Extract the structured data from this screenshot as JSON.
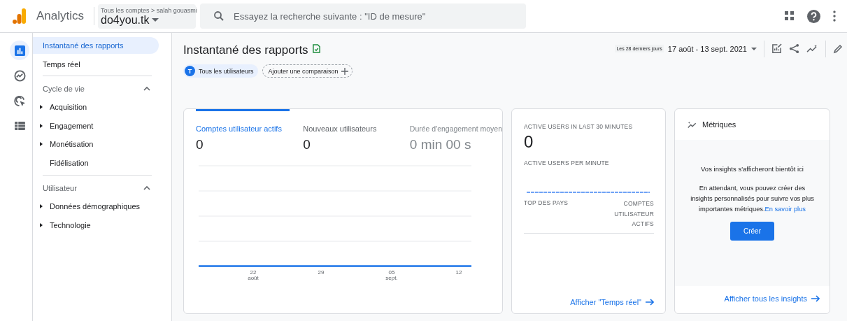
{
  "header": {
    "product": "Analytics",
    "breadcrumb": "Tous les comptes > salah gouasmi",
    "property": "do4you.tk",
    "search": {
      "placeholder": "Essayez la recherche suivante : \"ID de mesure\""
    }
  },
  "rail": [
    {
      "selected": true
    },
    {
      "selected": false
    },
    {
      "selected": false
    },
    {
      "selected": false
    }
  ],
  "sidebar": {
    "items": [
      {
        "label": "Instantané des rapports",
        "selected": true
      },
      {
        "label": "Temps réel",
        "selected": false
      }
    ],
    "sections": [
      {
        "title": "Cycle de vie",
        "expanded": true,
        "items": [
          {
            "label": "Acquisition",
            "kind": "group"
          },
          {
            "label": "Engagement",
            "kind": "group"
          },
          {
            "label": "Monétisation",
            "kind": "group"
          },
          {
            "label": "Fidélisation",
            "kind": "link"
          }
        ]
      },
      {
        "title": "Utilisateur",
        "expanded": true,
        "items": [
          {
            "label": "Données démographiques",
            "kind": "group"
          },
          {
            "label": "Technologie",
            "kind": "group"
          }
        ]
      }
    ]
  },
  "page": {
    "title": "Instantané des rapports",
    "segment": {
      "initial": "T",
      "label": "Tous les utilisateurs"
    },
    "add_comparison": "Ajouter une comparaison",
    "range_label": "Les 28 derniers jours",
    "date_range": "17 août - 13 sept. 2021"
  },
  "overview": {
    "metrics": [
      {
        "label": "Comptes utilisateur actifs",
        "value": "0",
        "selected": true
      },
      {
        "label": "Nouveaux utilisateurs",
        "value": "0",
        "selected": false
      },
      {
        "label": "Durée d'engagement moyen",
        "value": "0 min 00 s",
        "selected": false
      }
    ],
    "x_labels": [
      {
        "day": "22",
        "month": "août"
      },
      {
        "day": "29"
      },
      {
        "day": "05",
        "month": "sept."
      },
      {
        "day": "12"
      }
    ]
  },
  "realtime": {
    "title": "ACTIVE USERS IN LAST 30 MINUTES",
    "value": "0",
    "per_minute": "ACTIVE USERS PER MINUTE",
    "col_country": "TOP DES PAYS",
    "col_users": "COMPTES UTILISATEUR ACTIFS",
    "link": "Afficher \"Temps réel\""
  },
  "insights": {
    "title": "Métriques",
    "heading": "Vos insights s'afficheront bientôt ici",
    "body": "En attendant, vous pouvez créer des insights personnalisés pour suivre vos plus importantes métriques.",
    "learn_more": "En savoir plus",
    "button": "Créer",
    "link": "Afficher tous les insights"
  }
}
